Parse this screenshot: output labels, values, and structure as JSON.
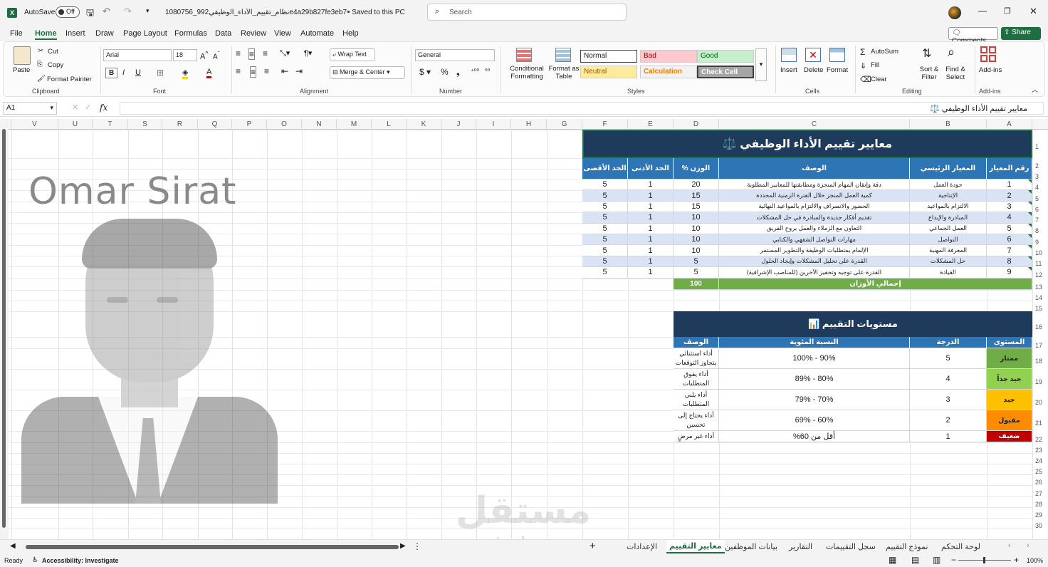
{
  "titlebar": {
    "autosave_label": "AutoSave",
    "autosave_state": "Off",
    "filename": "1080756_نظام_تقييم_الأداء_الوظيفي992e4a29b827fe3eb70b7d...",
    "saved_status": "• Saved to this PC",
    "search_placeholder": "Search"
  },
  "menu": [
    "File",
    "Home",
    "Insert",
    "Draw",
    "Page Layout",
    "Formulas",
    "Data",
    "Review",
    "View",
    "Automate",
    "Help"
  ],
  "menu_active": "Home",
  "menu_right": {
    "comments": "Comments",
    "share": "Share"
  },
  "ribbon": {
    "clipboard": {
      "paste": "Paste",
      "cut": "Cut",
      "copy": "Copy",
      "format_painter": "Format Painter",
      "label": "Clipboard"
    },
    "font": {
      "name": "Arial",
      "size": "18",
      "label": "Font"
    },
    "alignment": {
      "wrap": "Wrap Text",
      "merge": "Merge & Center",
      "label": "Alignment"
    },
    "number": {
      "format": "General",
      "label": "Number"
    },
    "styles": {
      "cond_format": "Conditional Formatting",
      "format_table": "Format as Table",
      "normal": "Normal",
      "bad": "Bad",
      "good": "Good",
      "neutral": "Neutral",
      "calculation": "Calculation",
      "check_cell": "Check Cell",
      "label": "Styles"
    },
    "cells": {
      "insert": "Insert",
      "delete": "Delete",
      "format": "Format",
      "label": "Cells"
    },
    "editing": {
      "autosum": "AutoSum",
      "fill": "Fill",
      "clear": "Clear",
      "sort": "Sort & Filter",
      "find": "Find & Select",
      "label": "Editing"
    },
    "addins": {
      "addins": "Add-ins",
      "label": "Add-ins"
    }
  },
  "formula_bar": {
    "name_box": "A1",
    "fx": "fx",
    "content": "معايير تقييم الأداء الوظيفي ⚖️"
  },
  "columns": [
    "V",
    "U",
    "T",
    "S",
    "R",
    "Q",
    "P",
    "O",
    "N",
    "M",
    "L",
    "K",
    "J",
    "I",
    "H",
    "G",
    "F",
    "E",
    "D",
    "C",
    "B",
    "A"
  ],
  "watermark_name": "Omar Sirat",
  "sheet": {
    "title": "معايير تقييم الأداء الوظيفي ⚖️",
    "headers": [
      "رقم المعيار",
      "المعيار الرئيسي",
      "الوصف",
      "الوزن %",
      "الحد الأدنى",
      "الحد الأقصى"
    ],
    "rows": [
      [
        "1",
        "جودة العمل",
        "دقة وإتقان المهام المنجزة ومطابقتها للمعايير المطلوبة",
        "20",
        "1",
        "5"
      ],
      [
        "2",
        "الإنتاجية",
        "كمية العمل المنجز خلال الفترة الزمنية المحددة",
        "15",
        "1",
        "5"
      ],
      [
        "3",
        "الالتزام بالمواعيد",
        "الحضور والانصراف والالتزام بالمواعيد النهائية",
        "15",
        "1",
        "5"
      ],
      [
        "4",
        "المبادرة والإبداع",
        "تقديم أفكار جديدة والمبادرة في حل المشكلات",
        "10",
        "1",
        "5"
      ],
      [
        "5",
        "العمل الجماعي",
        "التعاون مع الزملاء والعمل بروح الفريق",
        "10",
        "1",
        "5"
      ],
      [
        "6",
        "التواصل",
        "مهارات التواصل الشفهي والكتابي",
        "10",
        "1",
        "5"
      ],
      [
        "7",
        "المعرفة المهنية",
        "الإلمام بمتطلبات الوظيفة والتطوير المستمر",
        "10",
        "1",
        "5"
      ],
      [
        "8",
        "حل المشكلات",
        "القدرة على تحليل المشكلات وإيجاد الحلول",
        "5",
        "1",
        "5"
      ],
      [
        "9",
        "القيادة",
        "القدرة على توجيه وتحفيز الآخرين (للمناصب الإشرافية)",
        "5",
        "1",
        "5"
      ]
    ],
    "total_label": "إجمالي الأوزان",
    "total_value": "100",
    "levels_title": "مستويات التقييم 📊",
    "levels_headers": [
      "المستوى",
      "الدرجة",
      "النسبة المئوية",
      "الوصف"
    ],
    "levels": [
      {
        "name": "ممتاز",
        "score": "5",
        "pct": "90% - 100%",
        "desc": "أداء استثنائي يتجاوز التوقعات",
        "color": "#70ad47"
      },
      {
        "name": "جيد جداً",
        "score": "4",
        "pct": "80% - 89%",
        "desc": "أداء يفوق المتطلبات",
        "color": "#92d050"
      },
      {
        "name": "جيد",
        "score": "3",
        "pct": "70% - 79%",
        "desc": "أداء يلبي المتطلبات",
        "color": "#ffc000"
      },
      {
        "name": "مقبول",
        "score": "2",
        "pct": "60% - 69%",
        "desc": "أداء يحتاج إلى تحسين",
        "color": "#ff8c00"
      },
      {
        "name": "ضعيف",
        "score": "1",
        "pct": "أقل من 60%",
        "desc": "أداء غير مرضٍ",
        "color": "#c00000"
      }
    ]
  },
  "row_numbers": [
    "1",
    "2",
    "3",
    "4",
    "5",
    "6",
    "7",
    "8",
    "9",
    "10",
    "11",
    "12",
    "13",
    "14",
    "15",
    "16",
    "17",
    "18",
    "19",
    "20",
    "21",
    "22",
    "23",
    "24",
    "25",
    "26",
    "27",
    "28",
    "29",
    "30"
  ],
  "sheet_tabs": [
    "لوحة التحكم",
    "نموذج التقييم",
    "سجل التقييمات",
    "التقارير",
    "بيانات الموظفين",
    "معايير التقييم",
    "الإعدادات"
  ],
  "active_tab": "معايير التقييم",
  "watermark": {
    "ar": "مستقل",
    "en": "mostaql.com"
  },
  "status": {
    "ready": "Ready",
    "accessibility": "Accessibility: Investigate",
    "zoom": "100%"
  }
}
